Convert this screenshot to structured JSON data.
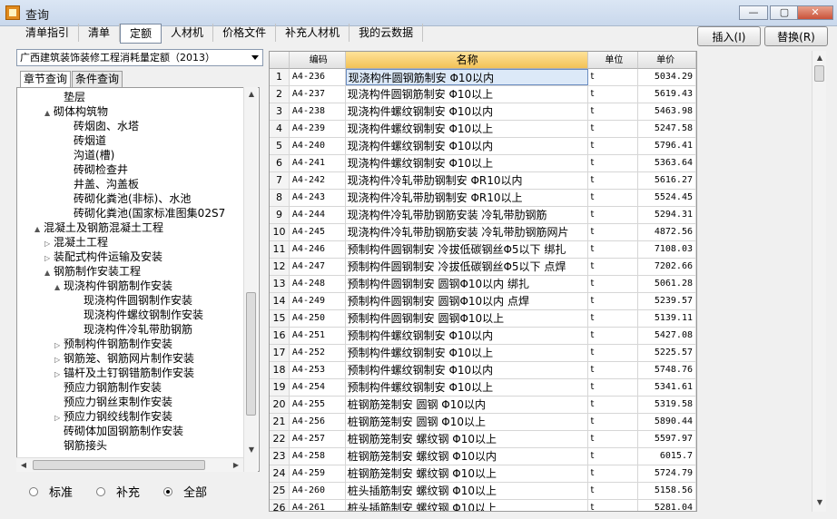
{
  "window": {
    "title": "查询",
    "min_label": "—",
    "max_label": "▢",
    "close_label": "✕"
  },
  "tabs": [
    "清单指引",
    "清单",
    "定额",
    "人材机",
    "价格文件",
    "补充人材机",
    "我的云数据"
  ],
  "active_tab": "定额",
  "buttons": {
    "insert": "插入(I)",
    "replace": "替换(R)"
  },
  "library": {
    "selected": "广西建筑装饰装修工程消耗量定额（2013）"
  },
  "subtabs": [
    "章节查询",
    "条件查询"
  ],
  "tree": [
    {
      "label": "垫层",
      "indent": 3,
      "toggle": ""
    },
    {
      "label": "砌体构筑物",
      "indent": 2,
      "toggle": "▲"
    },
    {
      "label": "砖烟囱、水塔",
      "indent": 4,
      "toggle": ""
    },
    {
      "label": "砖烟道",
      "indent": 4,
      "toggle": ""
    },
    {
      "label": "沟道(槽)",
      "indent": 4,
      "toggle": ""
    },
    {
      "label": "砖砌检查井",
      "indent": 4,
      "toggle": ""
    },
    {
      "label": "井盖、沟盖板",
      "indent": 4,
      "toggle": ""
    },
    {
      "label": "砖砌化粪池(非标)、水池",
      "indent": 4,
      "toggle": ""
    },
    {
      "label": "砖砌化粪池(国家标准图集02S7",
      "indent": 4,
      "toggle": ""
    },
    {
      "label": "混凝土及钢筋混凝土工程",
      "indent": 1,
      "toggle": "▲"
    },
    {
      "label": "混凝土工程",
      "indent": 2,
      "toggle": "▷"
    },
    {
      "label": "装配式构件运输及安装",
      "indent": 2,
      "toggle": "▷"
    },
    {
      "label": "钢筋制作安装工程",
      "indent": 2,
      "toggle": "▲"
    },
    {
      "label": "现浇构件钢筋制作安装",
      "indent": 3,
      "toggle": "▲"
    },
    {
      "label": "现浇构件圆钢制作安装",
      "indent": 5,
      "toggle": ""
    },
    {
      "label": "现浇构件螺纹钢制作安装",
      "indent": 5,
      "toggle": ""
    },
    {
      "label": "现浇构件冷轧带肋钢筋",
      "indent": 5,
      "toggle": ""
    },
    {
      "label": "预制构件钢筋制作安装",
      "indent": 3,
      "toggle": "▷"
    },
    {
      "label": "钢筋笼、钢筋网片制作安装",
      "indent": 3,
      "toggle": "▷"
    },
    {
      "label": "锚杆及土钉钢错筋制作安装",
      "indent": 3,
      "toggle": "▷"
    },
    {
      "label": "预应力钢筋制作安装",
      "indent": 3,
      "toggle": ""
    },
    {
      "label": "预应力钢丝束制作安装",
      "indent": 3,
      "toggle": ""
    },
    {
      "label": "预应力钢绞线制作安装",
      "indent": 3,
      "toggle": "▷"
    },
    {
      "label": "砖砌体加固钢筋制作安装",
      "indent": 3,
      "toggle": ""
    },
    {
      "label": "钢筋接头",
      "indent": 3,
      "toggle": ""
    }
  ],
  "radios": [
    {
      "label": "标准",
      "checked": false
    },
    {
      "label": "补充",
      "checked": false
    },
    {
      "label": "全部",
      "checked": true
    }
  ],
  "grid": {
    "headers": {
      "idx": "",
      "code": "编码",
      "name": "名称",
      "unit": "单位",
      "price": "单价"
    },
    "rows": [
      {
        "idx": "1",
        "code": "A4-236",
        "name": "现浇构件圆钢筋制安 Φ10以内",
        "unit": "t",
        "price": "5034.29"
      },
      {
        "idx": "2",
        "code": "A4-237",
        "name": "现浇构件圆钢筋制安 Φ10以上",
        "unit": "t",
        "price": "5619.43"
      },
      {
        "idx": "3",
        "code": "A4-238",
        "name": "现浇构件螺纹钢制安 Φ10以内",
        "unit": "t",
        "price": "5463.98"
      },
      {
        "idx": "4",
        "code": "A4-239",
        "name": "现浇构件螺纹钢制安 Φ10以上",
        "unit": "t",
        "price": "5247.58"
      },
      {
        "idx": "5",
        "code": "A4-240",
        "name": "现浇构件螺纹钢制安 Φ10以内",
        "unit": "t",
        "price": "5796.41"
      },
      {
        "idx": "6",
        "code": "A4-241",
        "name": "现浇构件螺纹钢制安 Φ10以上",
        "unit": "t",
        "price": "5363.64"
      },
      {
        "idx": "7",
        "code": "A4-242",
        "name": "现浇构件冷轧带肋钢制安 ΦR10以内",
        "unit": "t",
        "price": "5616.27"
      },
      {
        "idx": "8",
        "code": "A4-243",
        "name": "现浇构件冷轧带肋钢制安 ΦR10以上",
        "unit": "t",
        "price": "5524.45"
      },
      {
        "idx": "9",
        "code": "A4-244",
        "name": "现浇构件冷轧带肋钢筋安装 冷轧带肋钢筋",
        "unit": "t",
        "price": "5294.31"
      },
      {
        "idx": "10",
        "code": "A4-245",
        "name": "现浇构件冷轧带肋钢筋安装 冷轧带肋钢筋网片",
        "unit": "t",
        "price": "4872.56"
      },
      {
        "idx": "11",
        "code": "A4-246",
        "name": "预制构件圆钢制安 冷拔低碳钢丝Φ5以下 绑扎",
        "unit": "t",
        "price": "7108.03"
      },
      {
        "idx": "12",
        "code": "A4-247",
        "name": "预制构件圆钢制安 冷拔低碳钢丝Φ5以下 点焊",
        "unit": "t",
        "price": "7202.66"
      },
      {
        "idx": "13",
        "code": "A4-248",
        "name": "预制构件圆钢制安 圆钢Φ10以内 绑扎",
        "unit": "t",
        "price": "5061.28"
      },
      {
        "idx": "14",
        "code": "A4-249",
        "name": "预制构件圆钢制安 圆钢Φ10以内 点焊",
        "unit": "t",
        "price": "5239.57"
      },
      {
        "idx": "15",
        "code": "A4-250",
        "name": "预制构件圆钢制安 圆钢Φ10以上",
        "unit": "t",
        "price": "5139.11"
      },
      {
        "idx": "16",
        "code": "A4-251",
        "name": "预制构件螺纹钢制安 Φ10以内",
        "unit": "t",
        "price": "5427.08"
      },
      {
        "idx": "17",
        "code": "A4-252",
        "name": "预制构件螺纹钢制安 Φ10以上",
        "unit": "t",
        "price": "5225.57"
      },
      {
        "idx": "18",
        "code": "A4-253",
        "name": "预制构件螺纹钢制安 Φ10以内",
        "unit": "t",
        "price": "5748.76"
      },
      {
        "idx": "19",
        "code": "A4-254",
        "name": "预制构件螺纹钢制安 Φ10以上",
        "unit": "t",
        "price": "5341.61"
      },
      {
        "idx": "20",
        "code": "A4-255",
        "name": "桩钢筋笼制安 圆钢 Φ10以内",
        "unit": "t",
        "price": "5319.58"
      },
      {
        "idx": "21",
        "code": "A4-256",
        "name": "桩钢筋笼制安 圆钢 Φ10以上",
        "unit": "t",
        "price": "5890.44"
      },
      {
        "idx": "22",
        "code": "A4-257",
        "name": "桩钢筋笼制安 螺纹钢 Φ10以上",
        "unit": "t",
        "price": "5597.97"
      },
      {
        "idx": "23",
        "code": "A4-258",
        "name": "桩钢筋笼制安 螺纹钢 Φ10以内",
        "unit": "t",
        "price": "6015.7"
      },
      {
        "idx": "24",
        "code": "A4-259",
        "name": "桩钢筋笼制安 螺纹钢 Φ10以上",
        "unit": "t",
        "price": "5724.79"
      },
      {
        "idx": "25",
        "code": "A4-260",
        "name": "桩头插筋制安 螺纹钢 Φ10以上",
        "unit": "t",
        "price": "5158.56"
      },
      {
        "idx": "26",
        "code": "A4-261",
        "name": "桩头插筋制安 螺纹钢 Φ10以上",
        "unit": "t",
        "price": "5281.04"
      }
    ]
  }
}
